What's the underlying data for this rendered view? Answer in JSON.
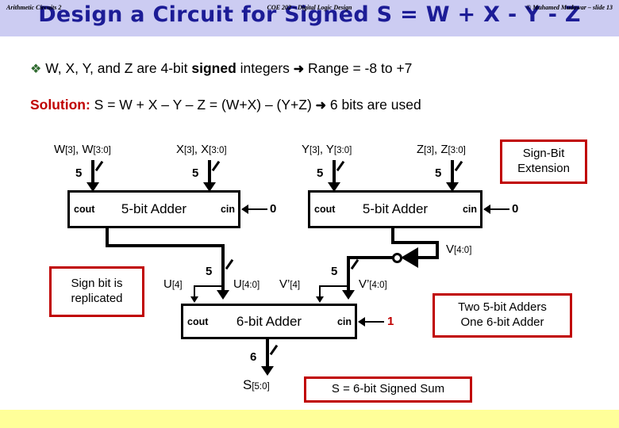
{
  "title": "Design a Circuit for Signed S = W + X - Y - Z",
  "title_bg": "#ccccf2",
  "title_color": "#1c1c96",
  "bullets": {
    "marker": "❖",
    "line1_a": "W, X, Y, and Z are 4-bit ",
    "line1_bold": "signed",
    "line1_b": " integers ",
    "line1_arrow": "➜",
    "line1_c": " Range = -8 to +7",
    "line2_label": "Solution:",
    "line2_a": " S = W + X – Y – Z = (W+X) – (Y+Z) ",
    "line2_arrow": "➜",
    "line2_b": " 6 bits are used",
    "solution_color": "#c00000"
  },
  "inputs": [
    {
      "name": "W",
      "label_main": "W",
      "label_sub1": "[3]",
      "label_sep": ", ",
      "label_main2": "W",
      "label_sub2": "[3:0]",
      "width": "5"
    },
    {
      "name": "X",
      "label_main": "X",
      "label_sub1": "[3]",
      "label_sep": ", ",
      "label_main2": "X",
      "label_sub2": "[3:0]",
      "width": "5"
    },
    {
      "name": "Y",
      "label_main": "Y",
      "label_sub1": "[3]",
      "label_sep": ", ",
      "label_main2": "Y",
      "label_sub2": "[3:0]",
      "width": "5"
    },
    {
      "name": "Z",
      "label_main": "Z",
      "label_sub1": "[3]",
      "label_sep": ", ",
      "label_main2": "Z",
      "label_sub2": "[3:0]",
      "width": "5"
    }
  ],
  "adders": {
    "left5": {
      "name": "5-bit Adder",
      "cout": "cout",
      "cin": "cin",
      "cin_value": "0"
    },
    "right5": {
      "name": "5-bit Adder",
      "cout": "cout",
      "cin": "cin",
      "cin_value": "0"
    },
    "main6": {
      "name": "6-bit Adder",
      "cout": "cout",
      "cin": "cin",
      "cin_value": "1",
      "cin_value_color": "#c00000"
    }
  },
  "signals": {
    "u4": "U",
    "u4_sub": "[4]",
    "u40": "U",
    "u40_sub": "[4:0]",
    "v40": "V",
    "v40_sub": "[4:0]",
    "vp4": "V’",
    "vp4_sub": "[4]",
    "vp40": "V’",
    "vp40_sub": "[4:0]",
    "s50": "S",
    "s50_sub": "[5:0]",
    "bus5_left": "5",
    "bus5_right": "5",
    "bus6": "6"
  },
  "callouts": {
    "sign_bit_extension": {
      "line1": "Sign-Bit",
      "line2": "Extension"
    },
    "sign_bit_replicated": {
      "line1": "Sign bit is",
      "line2": "replicated"
    },
    "adder_count": {
      "line1": "Two 5-bit Adders",
      "line2": "One 6-bit Adder"
    },
    "sum_note": {
      "line1": "S = 6-bit Signed Sum"
    }
  },
  "footer": {
    "left": "Arithmetic Circuits 2",
    "center": "COE 202 – Digital Logic Design",
    "right": "© Muhamed Mudawar – slide 13",
    "bg": "#ffff99"
  }
}
